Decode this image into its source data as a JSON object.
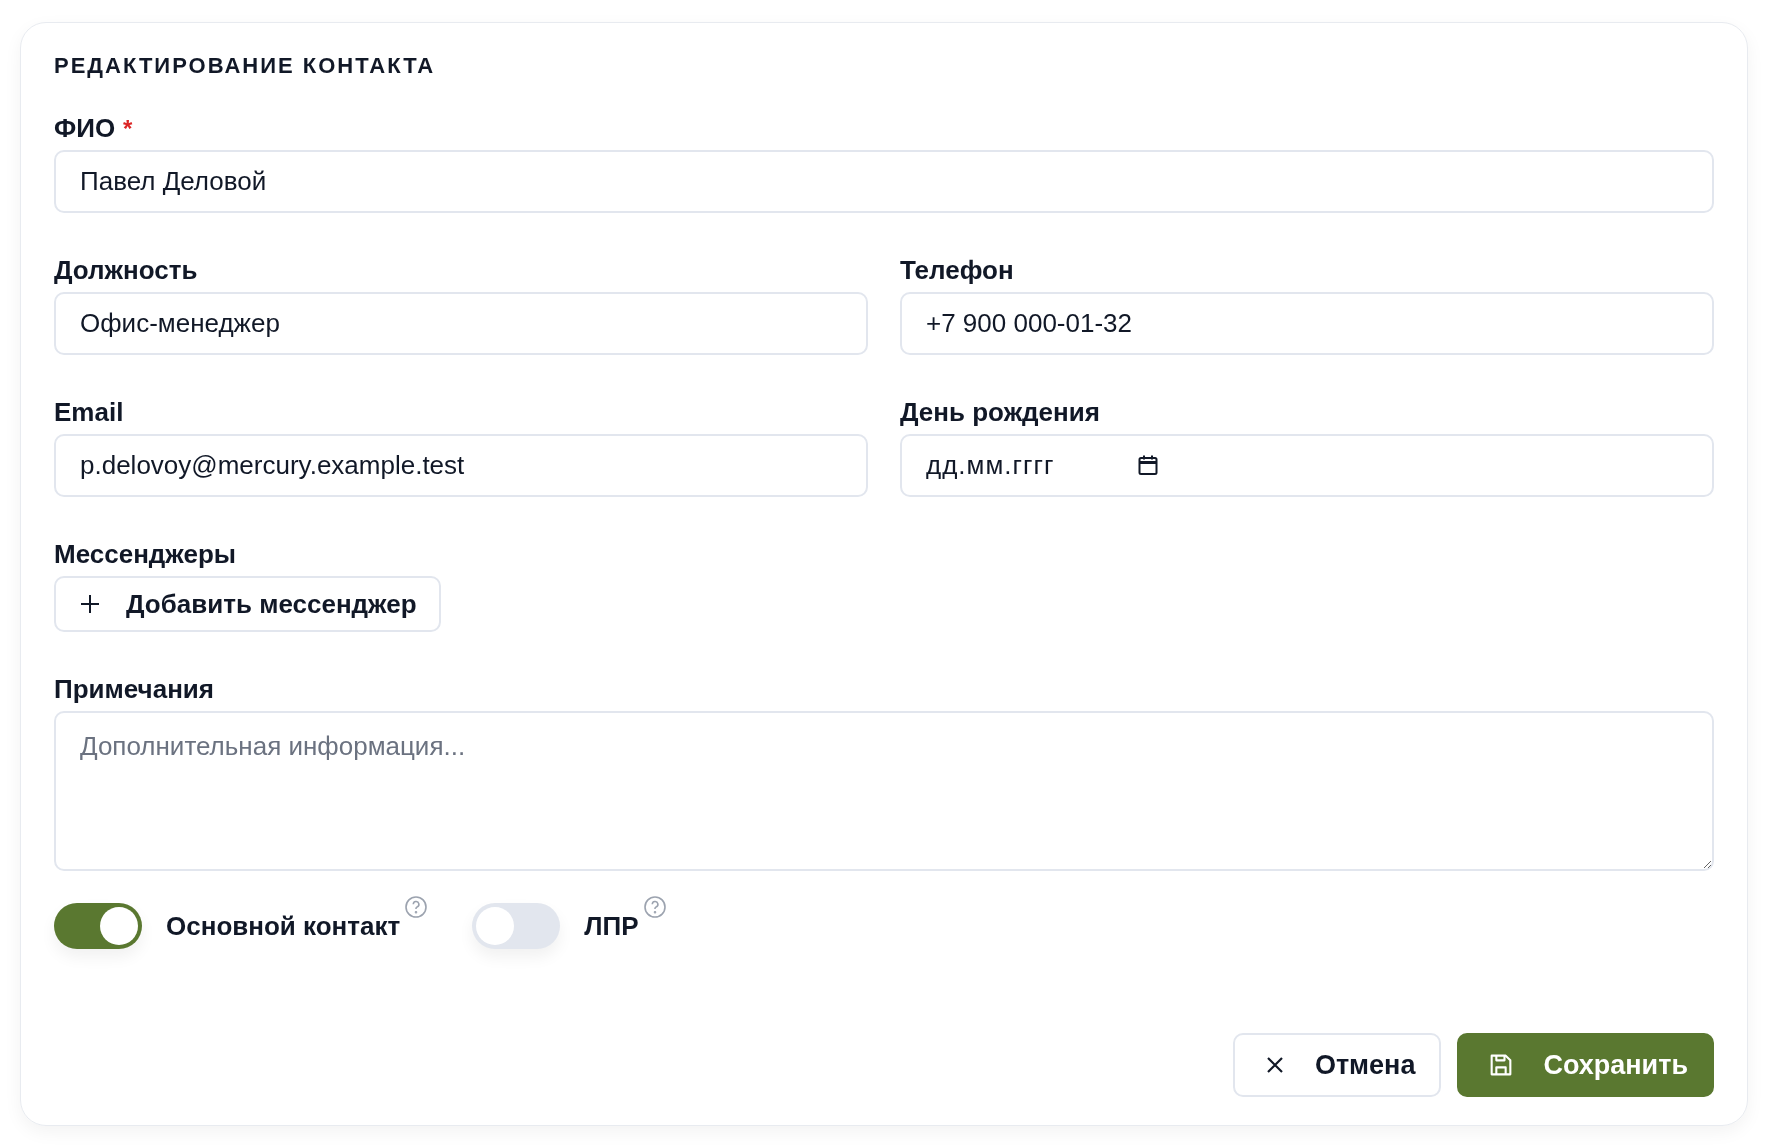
{
  "form": {
    "title": "РЕДАКТИРОВАНИЕ КОНТАКТА",
    "rows": [
      [
        {
          "kind": "text",
          "label": "ФИО",
          "required_mark": "*",
          "value": "Павел Деловой"
        }
      ],
      [
        {
          "kind": "text",
          "label": "Должность",
          "value": "Офис-менеджер"
        },
        {
          "kind": "text",
          "label": "Телефон",
          "value": "+7 900 000-01-32"
        }
      ],
      [
        {
          "kind": "text",
          "label": "Email",
          "value": "p.delovoy@mercury.example.test"
        },
        {
          "kind": "date",
          "label": "День рождения",
          "placeholder": "дд.мм.гггг"
        }
      ]
    ],
    "messengers": {
      "label": "Мессенджеры",
      "add_button": "Добавить мессенджер"
    },
    "notes": {
      "label": "Примечания",
      "placeholder": "Дополнительная информация..."
    },
    "toggles": [
      {
        "label": "Основной контакт",
        "on": true
      },
      {
        "label": "ЛПР",
        "on": false
      }
    ],
    "buttons": [
      {
        "kind": "secondary",
        "label": "Отмена"
      },
      {
        "kind": "primary",
        "label": "Сохранить"
      }
    ]
  }
}
